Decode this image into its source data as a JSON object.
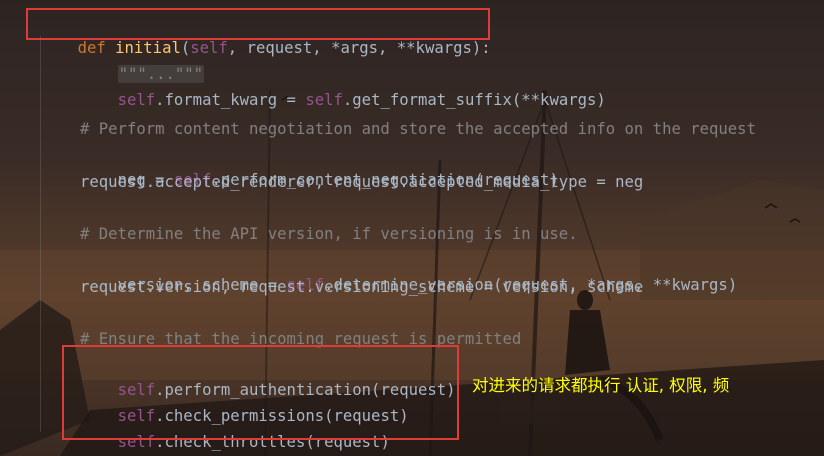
{
  "code": {
    "line1": {
      "def": "def",
      "fn": "initial",
      "open": "(",
      "self": "self",
      "rest": ", request, *args, **kwargs):"
    },
    "line2": {
      "fold": "\"\"\"...\"\"\""
    },
    "line3": {
      "self1": "self",
      "mid": ".format_kwarg = ",
      "self2": "self",
      "rest": ".get_format_suffix(**kwargs)"
    },
    "line5": {
      "comment": "# Perform content negotiation and store the accepted info on the request"
    },
    "line6": {
      "a": "neg = ",
      "self": "self",
      "b": ".perform_content_negotiation(request)"
    },
    "line7": {
      "text": "request.accepted_renderer, request.accepted_media_type = neg"
    },
    "line9": {
      "comment": "# Determine the API version, if versioning is in use."
    },
    "line10": {
      "a": "version, scheme = ",
      "self": "self",
      "b": ".determine_version(request, *args, **kwargs)"
    },
    "line11": {
      "text": "request.version, request.versioning_scheme = version, scheme"
    },
    "line13": {
      "comment": "# Ensure that the incoming request is permitted"
    },
    "line14": {
      "self": "self",
      "b": ".perform_authentication(request)"
    },
    "line15": {
      "self": "self",
      "b": ".check_permissions(request)"
    },
    "line16": {
      "self": "self",
      "b": ".check_throttles(request)"
    }
  },
  "annotation": {
    "text": "对进来的请求都执行 认证, 权限, 频"
  },
  "colors": {
    "keyword": "#cc7832",
    "function": "#ffc66d",
    "self": "#94558d",
    "comment": "#808080",
    "default": "#a9b7c6",
    "highlight_box": "#e03b3b",
    "annotation": "#ffff00"
  }
}
